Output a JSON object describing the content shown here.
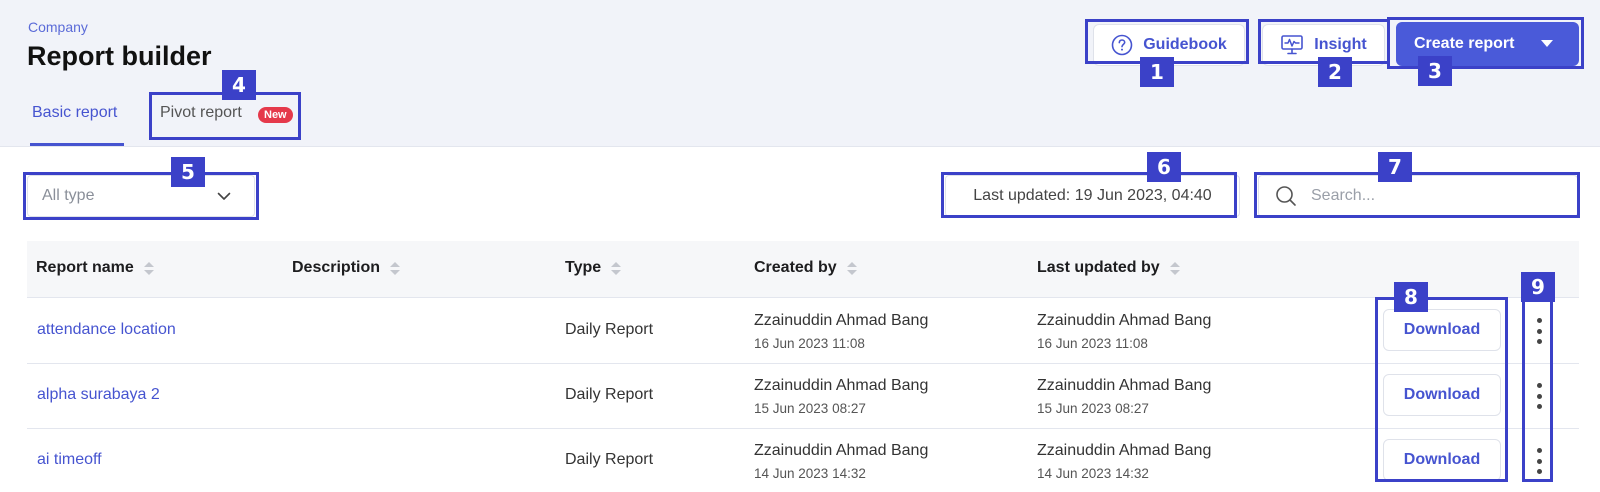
{
  "header": {
    "breadcrumb": "Company",
    "title": "Report builder",
    "guidebook_label": "Guidebook",
    "insight_label": "Insight",
    "create_label": "Create report"
  },
  "tabs": [
    {
      "label": "Basic report",
      "active": true
    },
    {
      "label": "Pivot report",
      "badge": "New"
    }
  ],
  "filters": {
    "type_select": "All type",
    "last_updated": "Last updated: 19 Jun 2023, 04:40",
    "search_placeholder": "Search..."
  },
  "table": {
    "columns": [
      "Report name",
      "Description",
      "Type",
      "Created by",
      "Last updated by"
    ],
    "download_label": "Download",
    "rows": [
      {
        "name": "attendance location",
        "description": "",
        "type": "Daily Report",
        "created_by": "Zzainuddin Ahmad Bang",
        "created_at": "16 Jun 2023 11:08",
        "updated_by": "Zzainuddin Ahmad Bang",
        "updated_at": "16 Jun 2023 11:08"
      },
      {
        "name": "alpha surabaya 2",
        "description": "",
        "type": "Daily Report",
        "created_by": "Zzainuddin Ahmad Bang",
        "created_at": "15 Jun 2023 08:27",
        "updated_by": "Zzainuddin Ahmad Bang",
        "updated_at": "15 Jun 2023 08:27"
      },
      {
        "name": "ai timeoff",
        "description": "",
        "type": "Daily Report",
        "created_by": "Zzainuddin Ahmad Bang",
        "created_at": "14 Jun 2023 14:32",
        "updated_by": "Zzainuddin Ahmad Bang",
        "updated_at": "14 Jun 2023 14:32"
      }
    ]
  },
  "annotations": [
    "1",
    "2",
    "3",
    "4",
    "5",
    "6",
    "7",
    "8",
    "9"
  ],
  "colors": {
    "accent": "#4654d0",
    "primary_button": "#4a5ad9",
    "badge": "#e5394b",
    "annotation": "#3b41c8",
    "header_bg": "#f1f3f9"
  },
  "icons": {
    "guidebook": "question-circle-icon",
    "insight": "monitor-pulse-icon",
    "create": "caret-down-icon",
    "select": "chevron-down-icon",
    "search": "search-icon",
    "row_menu": "kebab-menu-icon"
  }
}
